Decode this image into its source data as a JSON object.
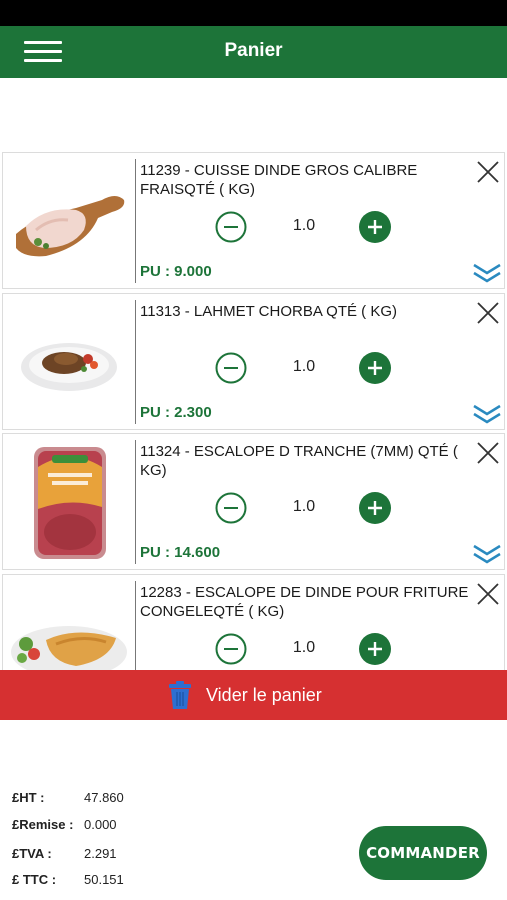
{
  "header": {
    "title": "Panier",
    "menu_icon": "hamburger-menu-icon"
  },
  "colors": {
    "brand_green": "#1d7439",
    "danger_red": "#d63031"
  },
  "cart": {
    "items": [
      {
        "title": "11239 - CUISSE DINDE GROS CALIBRE FRAISQTÉ ( KG)",
        "quantity": "1.0",
        "unit_price": "PU : 9.000",
        "image": "turkey-thigh-on-board"
      },
      {
        "title": "11313 - LAHMET CHORBA QTÉ ( KG)",
        "quantity": "1.0",
        "unit_price": "PU : 2.300",
        "image": "meat-plate"
      },
      {
        "title": "11324 - ESCALOPE D TRANCHE (7MM) QTÉ ( KG)",
        "quantity": "1.0",
        "unit_price": "PU : 14.600",
        "image": "escalope-package"
      },
      {
        "title": "12283 - ESCALOPE DE DINDE POUR FRITURE CONGELEQTÉ ( KG)",
        "quantity": "1.0",
        "unit_price": "",
        "image": "fried-escalope-plate"
      }
    ],
    "clear_label": "Vider le panier"
  },
  "totals": {
    "ht_label": "£HT :",
    "ht_value": "47.860",
    "remise_label": "£Remise :",
    "remise_value": "0.000",
    "tva_label": "£TVA :",
    "tva_value": "2.291",
    "ttc_label": "£ TTC :",
    "ttc_value": "50.151"
  },
  "order_button": "COMMANDER"
}
